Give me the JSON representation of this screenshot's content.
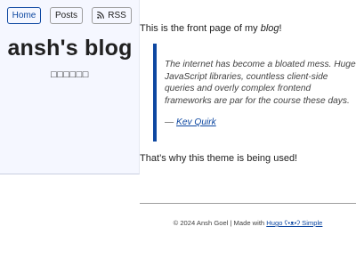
{
  "nav": {
    "home_label": "Home",
    "posts_label": "Posts",
    "rss_label": "RSS",
    "rss_icon": "rss-feed-icon"
  },
  "header": {
    "site_title": "ansh's blog",
    "subtitle": "□□□□□□"
  },
  "main": {
    "intro_prefix": "This is the front page of my ",
    "intro_emph": "blog",
    "intro_suffix": "!",
    "quote": {
      "text": "The internet has become a bloated mess. Huge JavaScript libraries, countless client-side queries and overly complex frontend frameworks are par for the course these days.",
      "cite_dash": "— ",
      "cite_name": "Kev Quirk"
    },
    "outro": "That’s why this theme is being used!"
  },
  "footer": {
    "copyright": "© 2024 Ansh Goel | Made with ",
    "link_label": "Hugo ʕ•ᴥ•ʔ Simple"
  },
  "colors": {
    "accent": "#0d47a1",
    "sidebar_bg": "#f5f7ff",
    "text": "#212121"
  }
}
